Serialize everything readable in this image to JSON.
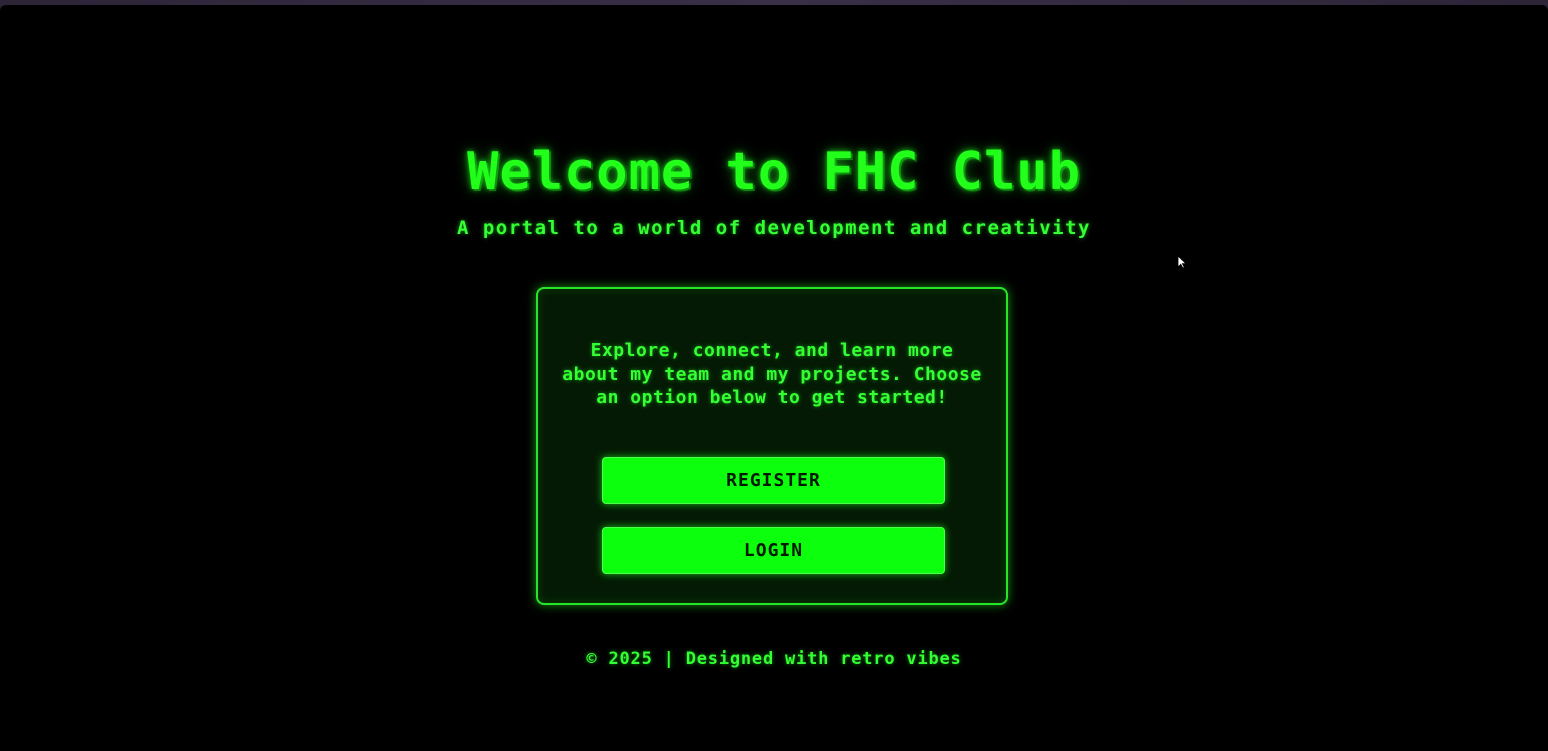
{
  "page": {
    "title": "Welcome to FHC Club",
    "subtitle": "A portal to a world of development and creativity"
  },
  "panel": {
    "description": "Explore, connect, and learn more about my team and my projects. Choose an option below to get started!",
    "register_label": "REGISTER",
    "login_label": "LOGIN"
  },
  "footer": {
    "text": "© 2025 | Designed with retro vibes"
  },
  "colors": {
    "background": "#000000",
    "accent": "#22ff1a",
    "panel_bg": "#041a04",
    "button_bg": "#0cff0c",
    "button_text": "#001a00"
  },
  "icons": {
    "cursor": "mouse-pointer-icon"
  }
}
